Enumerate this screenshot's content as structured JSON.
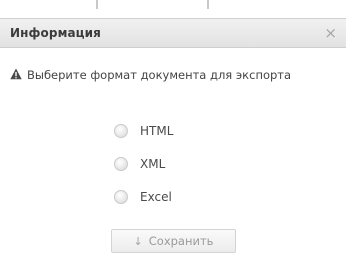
{
  "dialog": {
    "title": "Информация",
    "close_glyph": "×",
    "message": "Выберите формат документа для экспорта",
    "message_icon": "warning-icon"
  },
  "formats": [
    {
      "label": "HTML",
      "selected": false
    },
    {
      "label": "XML",
      "selected": false
    },
    {
      "label": "Excel",
      "selected": false
    }
  ],
  "save_button": {
    "label": "Сохранить",
    "icon": "download-icon",
    "icon_glyph": "↓"
  }
}
